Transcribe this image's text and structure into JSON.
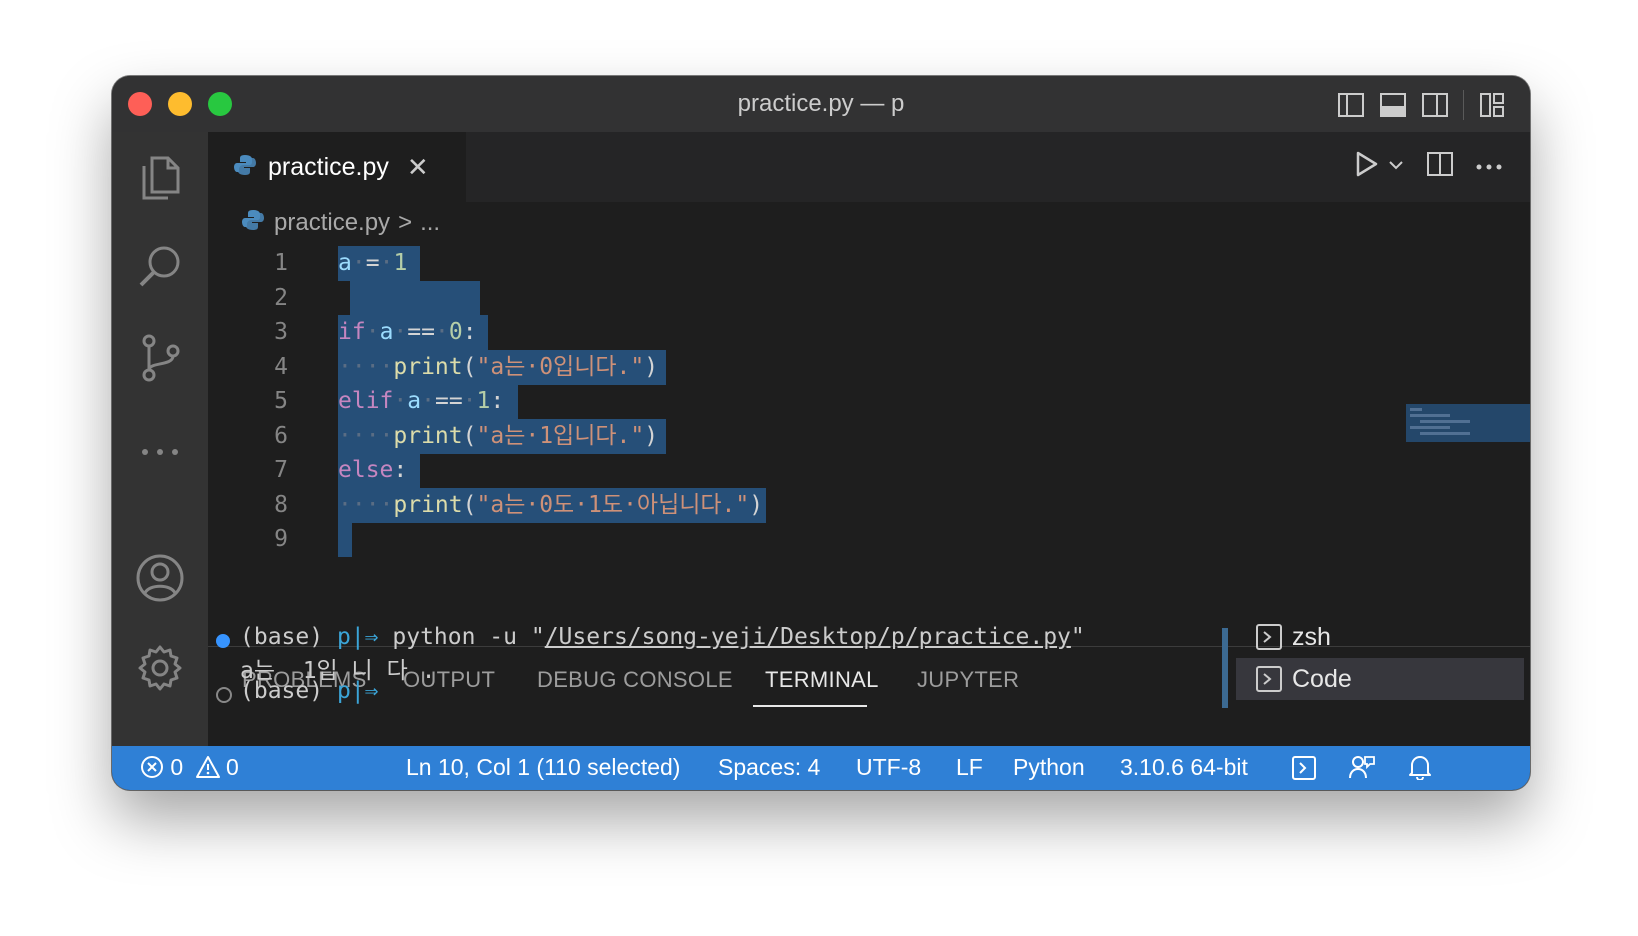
{
  "window": {
    "title": "practice.py — p"
  },
  "tab": {
    "label": "practice.py"
  },
  "breadcrumb": {
    "file": "practice.py",
    "separator": ">",
    "more": "..."
  },
  "editor": {
    "line_numbers": [
      "1",
      "2",
      "3",
      "4",
      "5",
      "6",
      "7",
      "8",
      "9"
    ],
    "lines": [
      [
        {
          "t": "a",
          "c": "var"
        },
        {
          "t": "·",
          "c": "indent"
        },
        {
          "t": "=",
          "c": "plain"
        },
        {
          "t": "·",
          "c": "indent"
        },
        {
          "t": "1",
          "c": "num"
        }
      ],
      [],
      [
        {
          "t": "if",
          "c": "kw"
        },
        {
          "t": "·",
          "c": "indent"
        },
        {
          "t": "a",
          "c": "var"
        },
        {
          "t": "·",
          "c": "indent"
        },
        {
          "t": "==",
          "c": "plain"
        },
        {
          "t": "·",
          "c": "indent"
        },
        {
          "t": "0",
          "c": "num"
        },
        {
          "t": ":",
          "c": "plain"
        }
      ],
      [
        {
          "t": "····",
          "c": "indent"
        },
        {
          "t": "print",
          "c": "fn"
        },
        {
          "t": "(",
          "c": "plain"
        },
        {
          "t": "\"a는·0입니다.\"",
          "c": "str"
        },
        {
          "t": ")",
          "c": "plain"
        }
      ],
      [
        {
          "t": "elif",
          "c": "kw"
        },
        {
          "t": "·",
          "c": "indent"
        },
        {
          "t": "a",
          "c": "var"
        },
        {
          "t": "·",
          "c": "indent"
        },
        {
          "t": "==",
          "c": "plain"
        },
        {
          "t": "·",
          "c": "indent"
        },
        {
          "t": "1",
          "c": "num"
        },
        {
          "t": ":",
          "c": "plain"
        }
      ],
      [
        {
          "t": "····",
          "c": "indent"
        },
        {
          "t": "print",
          "c": "fn"
        },
        {
          "t": "(",
          "c": "plain"
        },
        {
          "t": "\"a는·1입니다.\"",
          "c": "str"
        },
        {
          "t": ")",
          "c": "plain"
        }
      ],
      [
        {
          "t": "else",
          "c": "kw"
        },
        {
          "t": ":",
          "c": "plain"
        }
      ],
      [
        {
          "t": "····",
          "c": "indent"
        },
        {
          "t": "print",
          "c": "fn"
        },
        {
          "t": "(",
          "c": "plain"
        },
        {
          "t": "\"a는·0도·1도·아닙니다.\"",
          "c": "str"
        },
        {
          "t": ")",
          "c": "plain"
        }
      ],
      []
    ]
  },
  "panel": {
    "tabs": [
      "PROBLEMS",
      "OUTPUT",
      "DEBUG CONSOLE",
      "TERMINAL",
      "JUPYTER"
    ],
    "active_tab": "TERMINAL"
  },
  "terminal": {
    "env": "(base)",
    "dir": "p",
    "arrow": "|⇒",
    "command": "python -u \"",
    "path": "/Users/song-yeji/Desktop/p/practice.py",
    "command_end": "\"",
    "output": "a는  1입 니 다 .",
    "instances": [
      "zsh",
      "Code"
    ],
    "active_instance": "Code"
  },
  "status": {
    "errors": "0",
    "warnings": "0",
    "cursor": "Ln 10, Col 1 (110 selected)",
    "spaces": "Spaces: 4",
    "encoding": "UTF-8",
    "eol": "LF",
    "language": "Python",
    "interpreter": "3.10.6 64-bit"
  },
  "colors": {
    "accent": "#2f80d6",
    "selection": "#264f78",
    "keyword": "#c586c0",
    "string": "#ce9178",
    "function": "#dcdcaa"
  },
  "icons": [
    "files-icon",
    "search-icon",
    "source-control-icon",
    "more-icon",
    "account-icon",
    "settings-gear-icon",
    "python-icon",
    "run-icon",
    "split-editor-icon",
    "terminal-icon",
    "bell-icon",
    "feedback-icon"
  ]
}
